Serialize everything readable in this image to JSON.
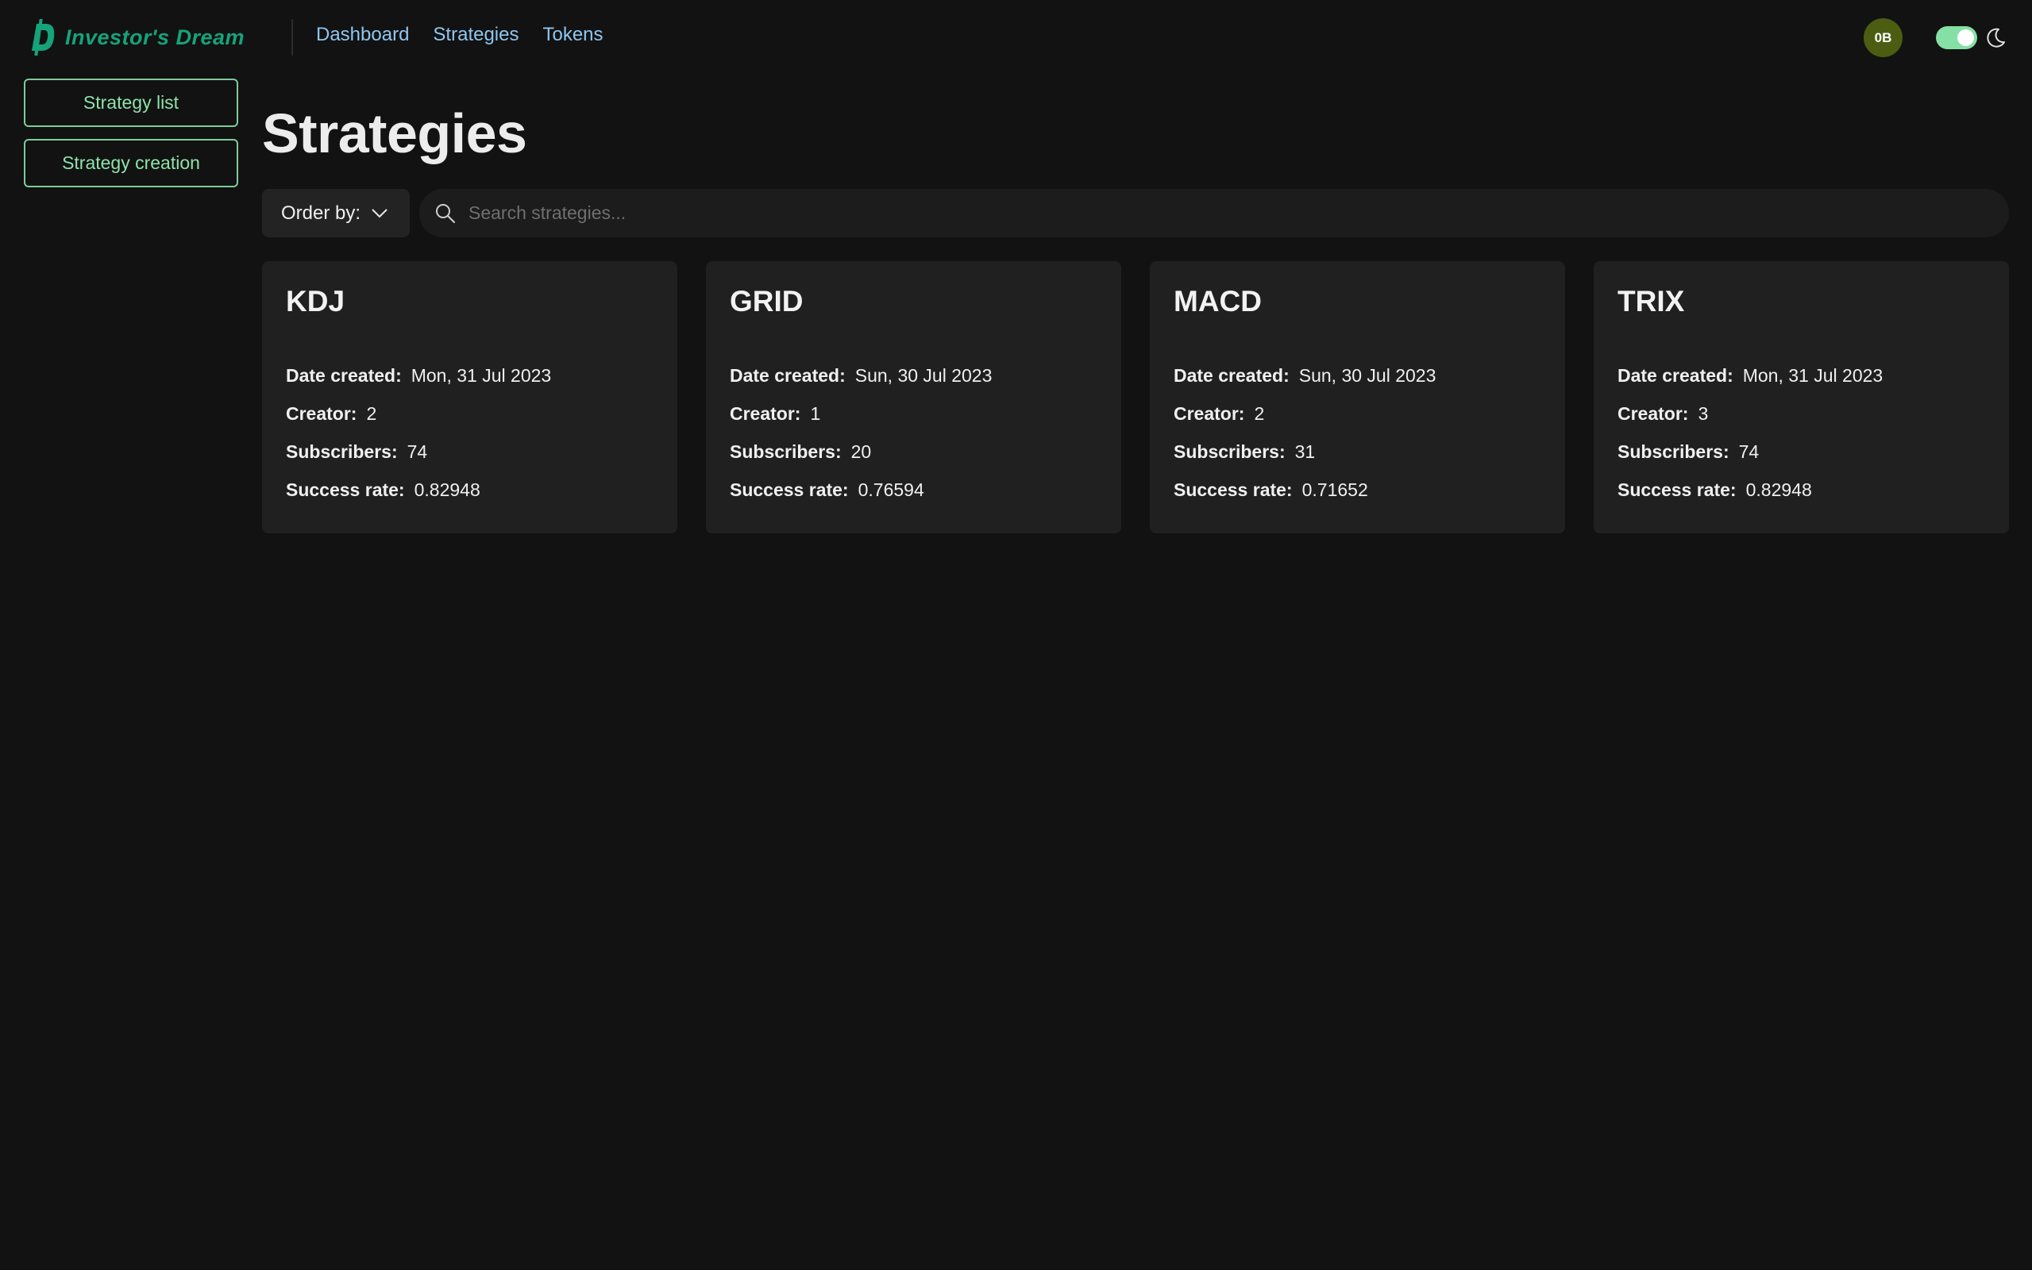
{
  "header": {
    "logo_text": "Investor's Dream",
    "nav": [
      "Dashboard",
      "Strategies",
      "Tokens"
    ],
    "avatar_initials": "0B",
    "theme_toggle_on": true
  },
  "sidebar": {
    "items": [
      {
        "label": "Strategy list"
      },
      {
        "label": "Strategy creation"
      }
    ]
  },
  "main": {
    "title": "Strategies",
    "order_by_label": "Order by:",
    "search_placeholder": "Search strategies..."
  },
  "labels": {
    "date_created": "Date created:",
    "creator": "Creator:",
    "subscribers": "Subscribers:",
    "success_rate": "Success rate:"
  },
  "strategies": [
    {
      "name": "KDJ",
      "date_created": "Mon, 31 Jul 2023",
      "creator": "2",
      "subscribers": "74",
      "success_rate": "0.82948"
    },
    {
      "name": "GRID",
      "date_created": "Sun, 30 Jul 2023",
      "creator": "1",
      "subscribers": "20",
      "success_rate": "0.76594"
    },
    {
      "name": "MACD",
      "date_created": "Sun, 30 Jul 2023",
      "creator": "2",
      "subscribers": "31",
      "success_rate": "0.71652"
    },
    {
      "name": "TRIX",
      "date_created": "Mon, 31 Jul 2023",
      "creator": "3",
      "subscribers": "74",
      "success_rate": "0.82948"
    }
  ],
  "colors": {
    "background": "#121212",
    "accent": "#16a37a",
    "nav_link": "#8fc6f0",
    "sidebar_button": "#8de2aa",
    "card": "#202020"
  },
  "icons": {
    "logo": "dollar-d-logo-icon",
    "order_by": "chevron-down-icon",
    "search": "search-icon",
    "theme": "moon-icon"
  }
}
